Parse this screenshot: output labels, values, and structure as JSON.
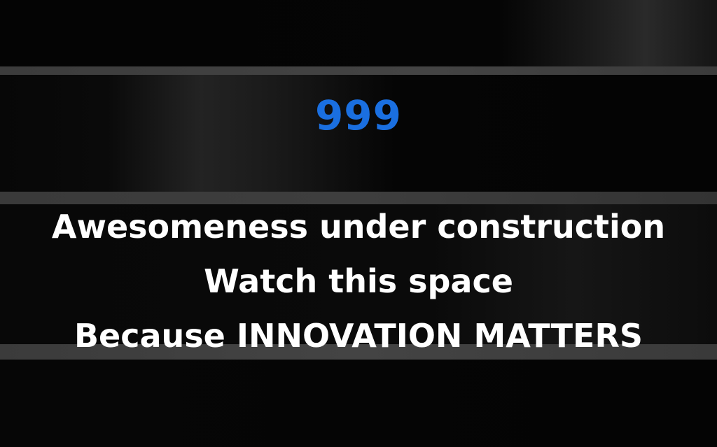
{
  "counter": {
    "value": "999",
    "color": "#1a6fe0"
  },
  "message": {
    "lines": [
      "Awesomeness under construction",
      "Watch this space",
      "Because INNOVATION MATTERS"
    ],
    "color": "#ffffff"
  },
  "theme": {
    "background": "#060606",
    "stripe": "#3c3c3c"
  }
}
